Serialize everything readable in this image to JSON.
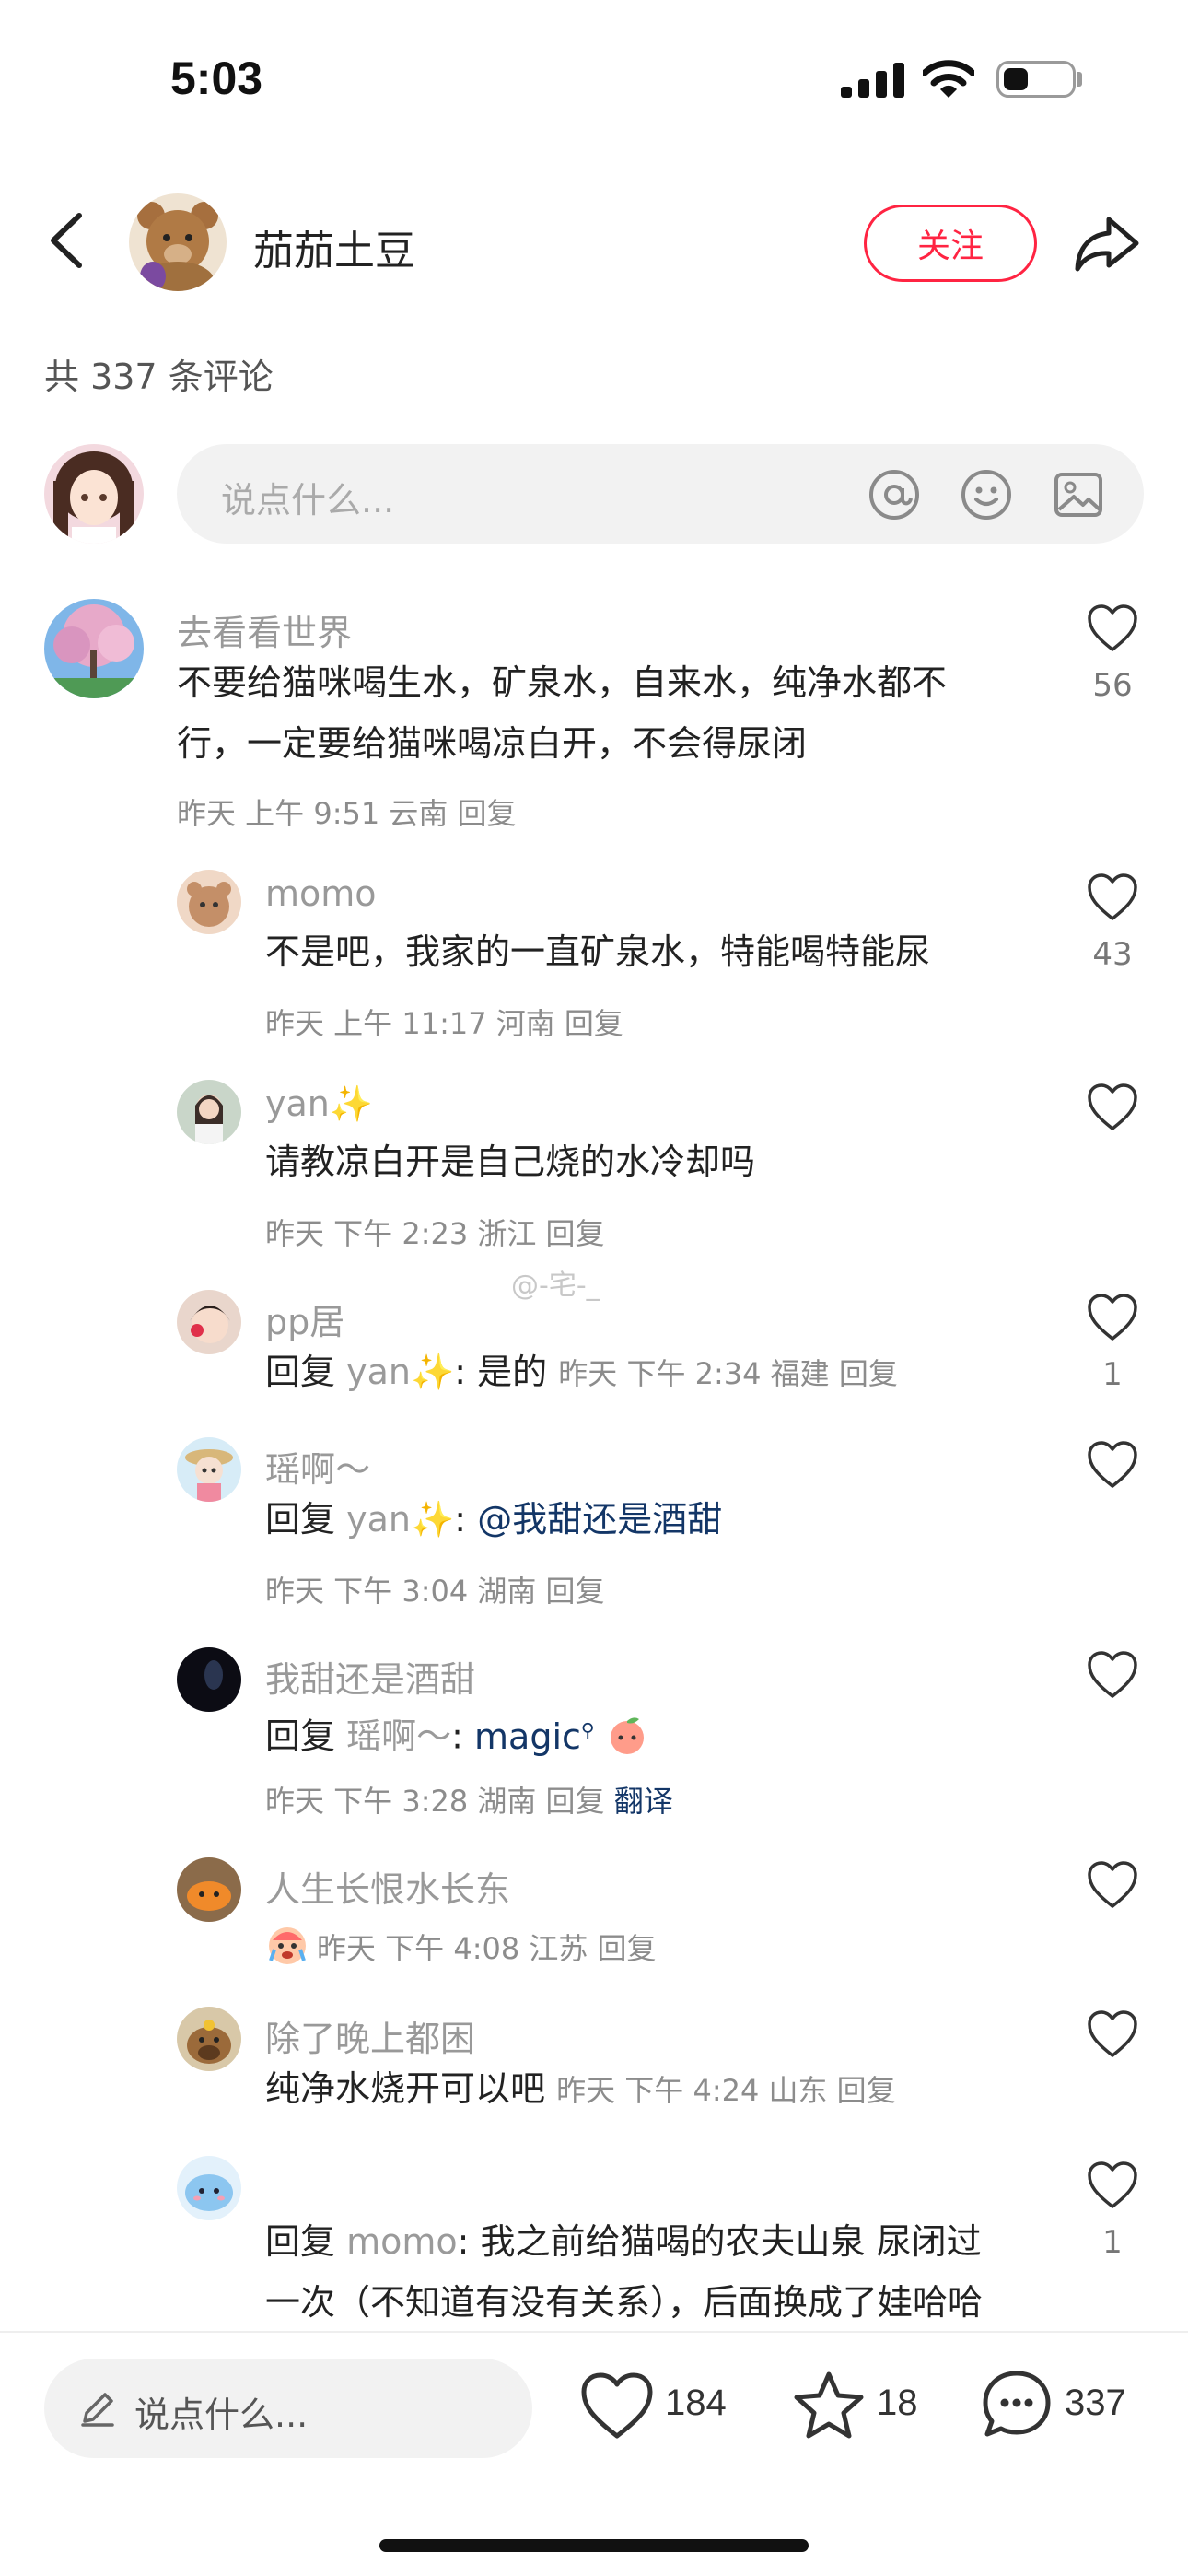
{
  "status_bar": {
    "time": "5:03",
    "battery_level": 0.35
  },
  "header": {
    "author_name": "茄茄土豆",
    "follow_label": "关注"
  },
  "comment_count_label": "共 337 条评论",
  "composer": {
    "placeholder": "说点什么..."
  },
  "watermark": "@-宅-_",
  "comments": [
    {
      "name": "去看看世界",
      "text_lines": [
        "不要给猫咪喝生水，矿泉水，自来水，纯净水都不",
        "行，一定要给猫咪喝凉白开，不会得尿闭"
      ],
      "meta": "昨天 上午 9:51 云南 回复",
      "likes": "56"
    },
    {
      "name": "momo",
      "text": "不是吧，我家的一直矿泉水，特能喝特能尿",
      "meta": "昨天 上午 11:17 河南 回复",
      "likes": "43"
    },
    {
      "name": "yan",
      "name_emoji": "✨",
      "text": "请教凉白开是自己烧的水冷却吗",
      "meta": "昨天 下午 2:23 浙江 回复",
      "likes": ""
    },
    {
      "name": "pp居",
      "reply_prefix": "回复",
      "reply_to": "yan✨",
      "text": ": 是的",
      "meta": "昨天 下午 2:34 福建 回复",
      "likes": "1"
    },
    {
      "name": "瑶啊～",
      "reply_prefix": "回复",
      "reply_to": "yan✨",
      "text_colon": ": ",
      "mention": "@我甜还是酒甜",
      "meta": "昨天 下午 3:04 湖南 回复",
      "likes": ""
    },
    {
      "name": "我甜还是酒甜",
      "reply_prefix": "回复",
      "reply_to": "瑶啊～",
      "text_colon": ": ",
      "mention": "magic",
      "meta": "昨天 下午 3:28 湖南 回复",
      "translate": "翻译",
      "likes": ""
    },
    {
      "name": "人生长恨水长东",
      "meta": "昨天 下午 4:08 江苏 回复",
      "likes": ""
    },
    {
      "name": "除了晚上都困",
      "text": "纯净水烧开可以吧",
      "meta": "昨天 下午 4:24 山东 回复",
      "likes": ""
    },
    {
      "name": "",
      "reply_prefix": "回复",
      "reply_to": "momo",
      "text_line1": ": 我之前给猫喝的农夫山泉 尿闭过",
      "text_line2": "一次（不知道有没有关系），后面换成了娃哈哈",
      "likes": "1"
    }
  ],
  "bottom_bar": {
    "input_placeholder": "说点什么...",
    "likes": "184",
    "favorites": "18",
    "comments": "337"
  }
}
